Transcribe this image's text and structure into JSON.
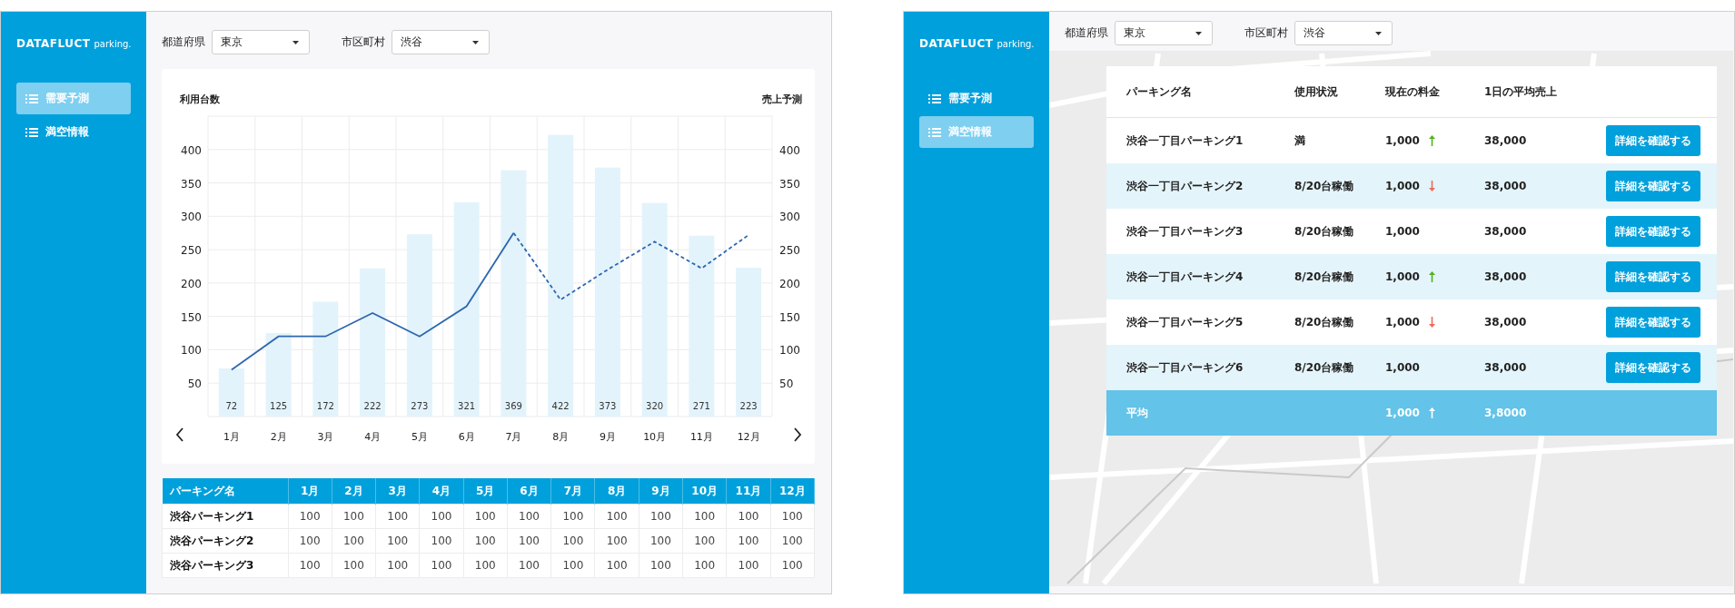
{
  "screens": [
    {
      "kind": "demand",
      "sidebar": {
        "logo": "DATAFLUCT",
        "logo_suffix": "parking.",
        "items": [
          {
            "label": "需要予測",
            "selected": true
          },
          {
            "label": "満空情報",
            "selected": false
          }
        ]
      },
      "filters": [
        {
          "label": "都道府県",
          "value": "東京"
        },
        {
          "label": "市区町村",
          "value": "渋谷"
        }
      ],
      "chart": {
        "right_axis_title": "売上予測",
        "right_axis_ticks": [
          "400",
          "350",
          "300",
          "250",
          "200",
          "150",
          "100",
          "50"
        ],
        "chart_data": {
          "type": "bar",
          "ylabel": "利用台数",
          "categories": [
            "1月",
            "2月",
            "3月",
            "4月",
            "5月",
            "6月",
            "7月",
            "8月",
            "9月",
            "10月",
            "11月",
            "12月"
          ],
          "ylim": [
            0,
            450
          ],
          "yticks": [
            50,
            100,
            150,
            200,
            250,
            300,
            350,
            400
          ],
          "grid": true,
          "series": [
            {
              "type": "bar",
              "color": "#e3f3fb",
              "values": [
                72,
                125,
                172,
                222,
                273,
                321,
                369,
                422,
                373,
                320,
                271,
                223
              ],
              "value_labels": [
                "72",
                "125",
                "172",
                "222",
                "273",
                "321",
                "369",
                "422",
                "373",
                "320",
                "271",
                "223"
              ]
            },
            {
              "type": "line",
              "line_style": "solid",
              "color": "#2d67b0",
              "values": [
                70,
                120,
                120,
                155,
                120,
                165,
                275,
                null,
                null,
                null,
                null,
                null
              ]
            },
            {
              "type": "line",
              "line_style": "dashed",
              "color": "#2d67b0",
              "values": [
                null,
                null,
                null,
                null,
                null,
                null,
                275,
                175,
                220,
                262,
                222,
                272
              ]
            }
          ]
        }
      },
      "table": {
        "columns": [
          "パーキング名",
          "1月",
          "2月",
          "3月",
          "4月",
          "5月",
          "6月",
          "7月",
          "8月",
          "9月",
          "10月",
          "11月",
          "12月"
        ],
        "rows": [
          {
            "name": "渋谷パーキング1",
            "values": [
              "100",
              "100",
              "100",
              "100",
              "100",
              "100",
              "100",
              "100",
              "100",
              "100",
              "100",
              "100"
            ]
          },
          {
            "name": "渋谷パーキング2",
            "values": [
              "100",
              "100",
              "100",
              "100",
              "100",
              "100",
              "100",
              "100",
              "100",
              "100",
              "100",
              "100"
            ]
          },
          {
            "name": "渋谷パーキング3",
            "values": [
              "100",
              "100",
              "100",
              "100",
              "100",
              "100",
              "100",
              "100",
              "100",
              "100",
              "100",
              "100"
            ]
          }
        ]
      }
    },
    {
      "kind": "vacancy",
      "sidebar": {
        "logo": "DATAFLUCT",
        "logo_suffix": "parking.",
        "items": [
          {
            "label": "需要予測",
            "selected": false
          },
          {
            "label": "満空情報",
            "selected": true
          }
        ]
      },
      "filters": [
        {
          "label": "都道府県",
          "value": "東京"
        },
        {
          "label": "市区町村",
          "value": "渋谷"
        }
      ],
      "lots_table": {
        "columns": [
          "パーキング名",
          "使用状況",
          "現在の料金",
          "1日の平均売上"
        ],
        "rows": [
          {
            "name": "渋谷一丁目パーキング1",
            "status": "満",
            "price": "1,000",
            "price_up": true,
            "price_down": false,
            "sales": "38,000",
            "action": "詳細を確認する"
          },
          {
            "name": "渋谷一丁目パーキング2",
            "status": "8/20台稼働",
            "price": "1,000",
            "price_up": false,
            "price_down": true,
            "sales": "38,000",
            "action": "詳細を確認する"
          },
          {
            "name": "渋谷一丁目パーキング3",
            "status": "8/20台稼働",
            "price": "1,000",
            "price_up": false,
            "price_down": false,
            "sales": "38,000",
            "action": "詳細を確認する"
          },
          {
            "name": "渋谷一丁目パーキング4",
            "status": "8/20台稼働",
            "price": "1,000",
            "price_up": true,
            "price_down": false,
            "sales": "38,000",
            "action": "詳細を確認する"
          },
          {
            "name": "渋谷一丁目パーキング5",
            "status": "8/20台稼働",
            "price": "1,000",
            "price_up": false,
            "price_down": true,
            "sales": "38,000",
            "action": "詳細を確認する"
          },
          {
            "name": "渋谷一丁目パーキング6",
            "status": "8/20台稼働",
            "price": "1,000",
            "price_up": false,
            "price_down": false,
            "sales": "38,000",
            "action": "詳細を確認する"
          }
        ],
        "average": {
          "label": "平均",
          "price": "1,000",
          "price_up": true,
          "price_down": false,
          "sales": "3,8000"
        }
      }
    }
  ]
}
